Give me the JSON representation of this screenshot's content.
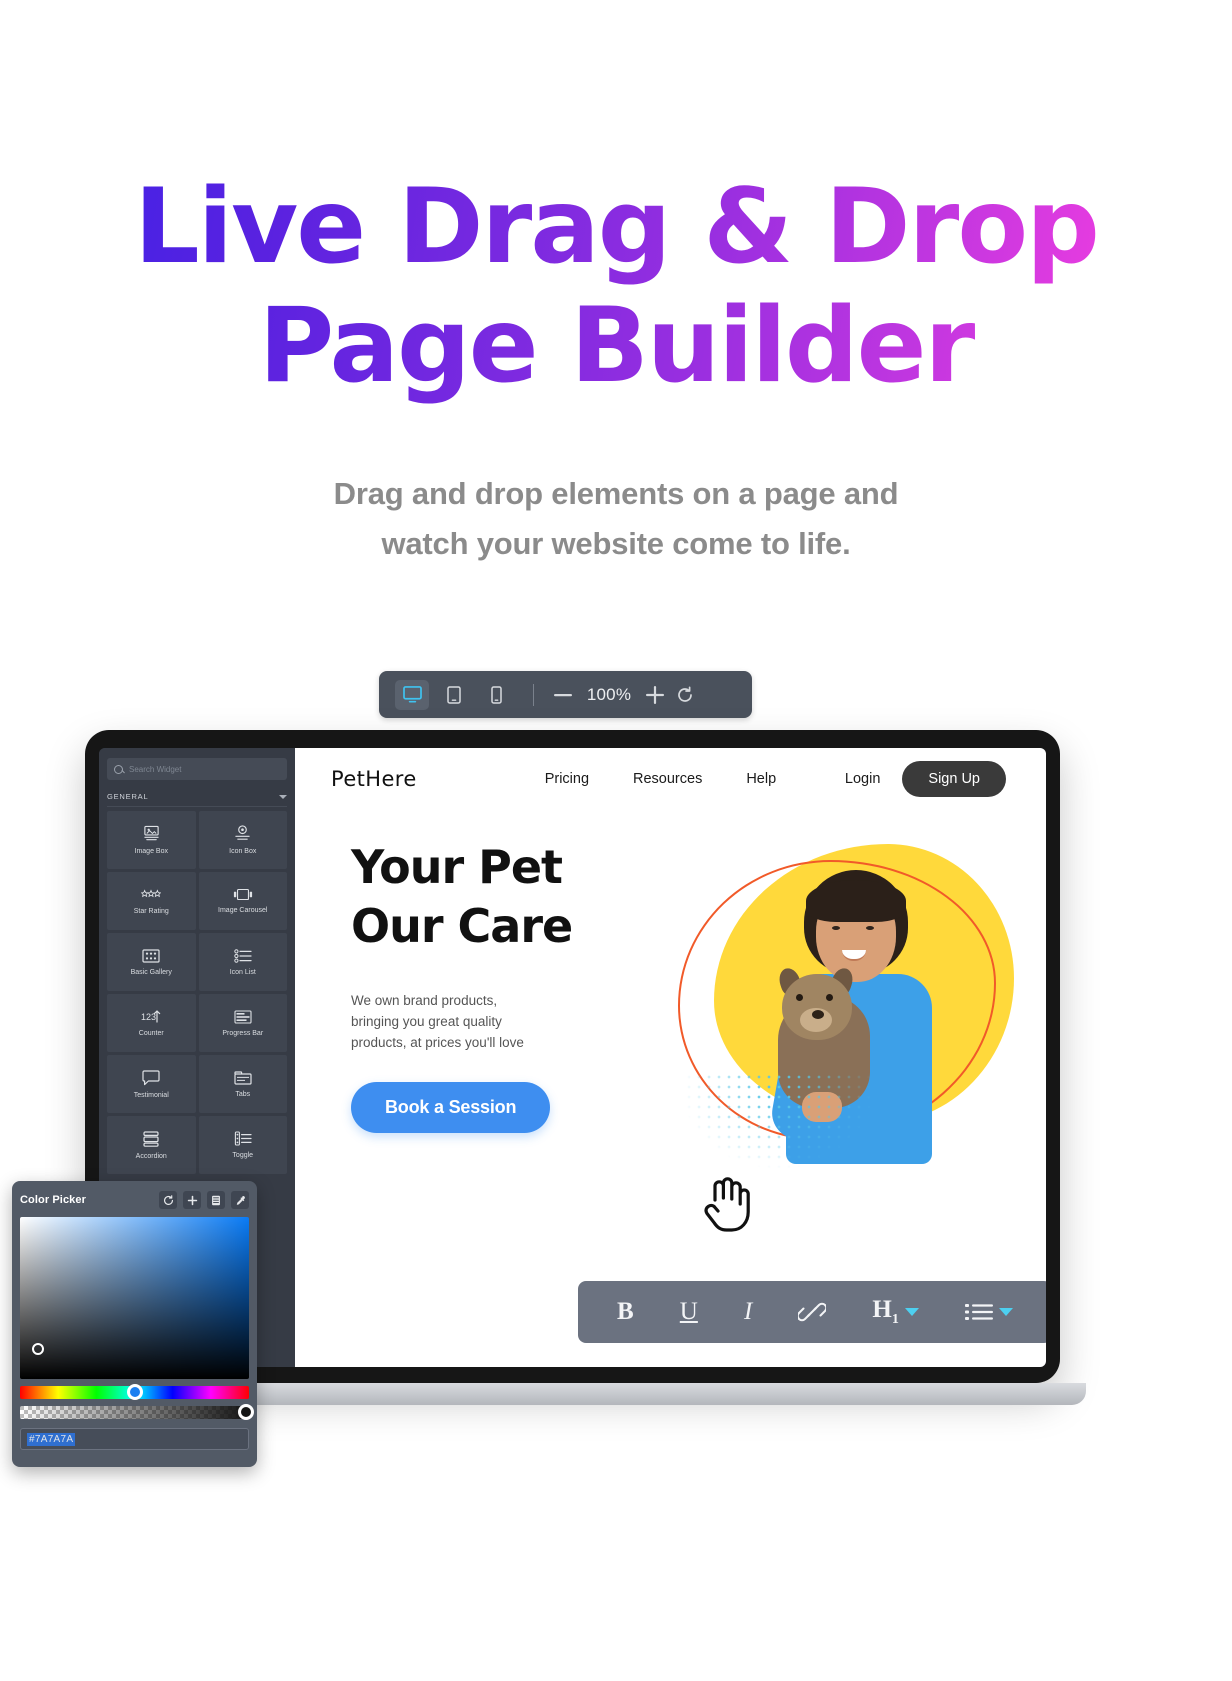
{
  "hero": {
    "title_line1": "Live Drag & Drop",
    "title_line2": "Page Builder",
    "subtitle_line1": "Drag and drop elements on a page and",
    "subtitle_line2": "watch your website come to life.",
    "gradient_start": "#3a23e8",
    "gradient_end": "#f23ad0",
    "subtitle_color": "#8b8b8b"
  },
  "device_toolbar": {
    "desktop_icon": "desktop-icon",
    "tablet_icon": "tablet-icon",
    "mobile_icon": "mobile-icon",
    "zoom_out_label": "—",
    "zoom_value": "100%",
    "zoom_in_label": "+",
    "reset_label": "↺",
    "active_device": "desktop",
    "active_color": "#3fc3f0",
    "background": "#4a515c"
  },
  "editor_sidebar": {
    "search_placeholder": "Search Widget",
    "section_label": "GENERAL",
    "widgets": [
      {
        "label": "Image Box",
        "icon": "image-box-icon"
      },
      {
        "label": "Icon Box",
        "icon": "icon-box-icon"
      },
      {
        "label": "Star Rating",
        "icon": "star-rating-icon"
      },
      {
        "label": "Image Carousel",
        "icon": "image-carousel-icon"
      },
      {
        "label": "Basic Gallery",
        "icon": "basic-gallery-icon"
      },
      {
        "label": "Icon List",
        "icon": "icon-list-icon"
      },
      {
        "label": "Counter",
        "icon": "counter-icon"
      },
      {
        "label": "Progress Bar",
        "icon": "progress-bar-icon"
      },
      {
        "label": "Testimonial",
        "icon": "testimonial-icon"
      },
      {
        "label": "Tabs",
        "icon": "tabs-icon"
      },
      {
        "label": "Accordion",
        "icon": "accordion-icon"
      },
      {
        "label": "Toggle",
        "icon": "toggle-icon"
      }
    ]
  },
  "website": {
    "logo": "PetHere",
    "nav_links": [
      "Pricing",
      "Resources",
      "Help"
    ],
    "login_label": "Login",
    "signup_label": "Sign Up",
    "headline_line1": "Your Pet",
    "headline_line2": "Our Care",
    "paragraph_line1": "We own brand products,",
    "paragraph_line2": "bringing you great quality",
    "paragraph_line3": "products, at prices you'll love",
    "cta_label": "Book a Session",
    "cta_color": "#3e8ef0",
    "accent_yellow": "#ffd93b",
    "accent_orange": "#f15a29",
    "accent_cyan": "#57c7e8"
  },
  "rich_text_toolbar": {
    "bold_label": "B",
    "underline_label": "U",
    "italic_label": "I",
    "link_icon": "link-icon",
    "heading_label": "H",
    "heading_level": "1",
    "list_icon": "bullet-list-icon",
    "background": "#6b7280",
    "caret_color": "#4dd0f0"
  },
  "color_picker": {
    "title": "Color Picker",
    "tools": [
      {
        "icon": "reset-icon",
        "glyph": "↺"
      },
      {
        "icon": "add-icon",
        "glyph": "+"
      },
      {
        "icon": "library-icon",
        "glyph": "▤"
      },
      {
        "icon": "eyedropper-icon",
        "glyph": "✐"
      }
    ],
    "hex_value": "#7A7A7A",
    "hue_position_percent": 55,
    "alpha_position_percent": 100,
    "background": "#525a66"
  }
}
